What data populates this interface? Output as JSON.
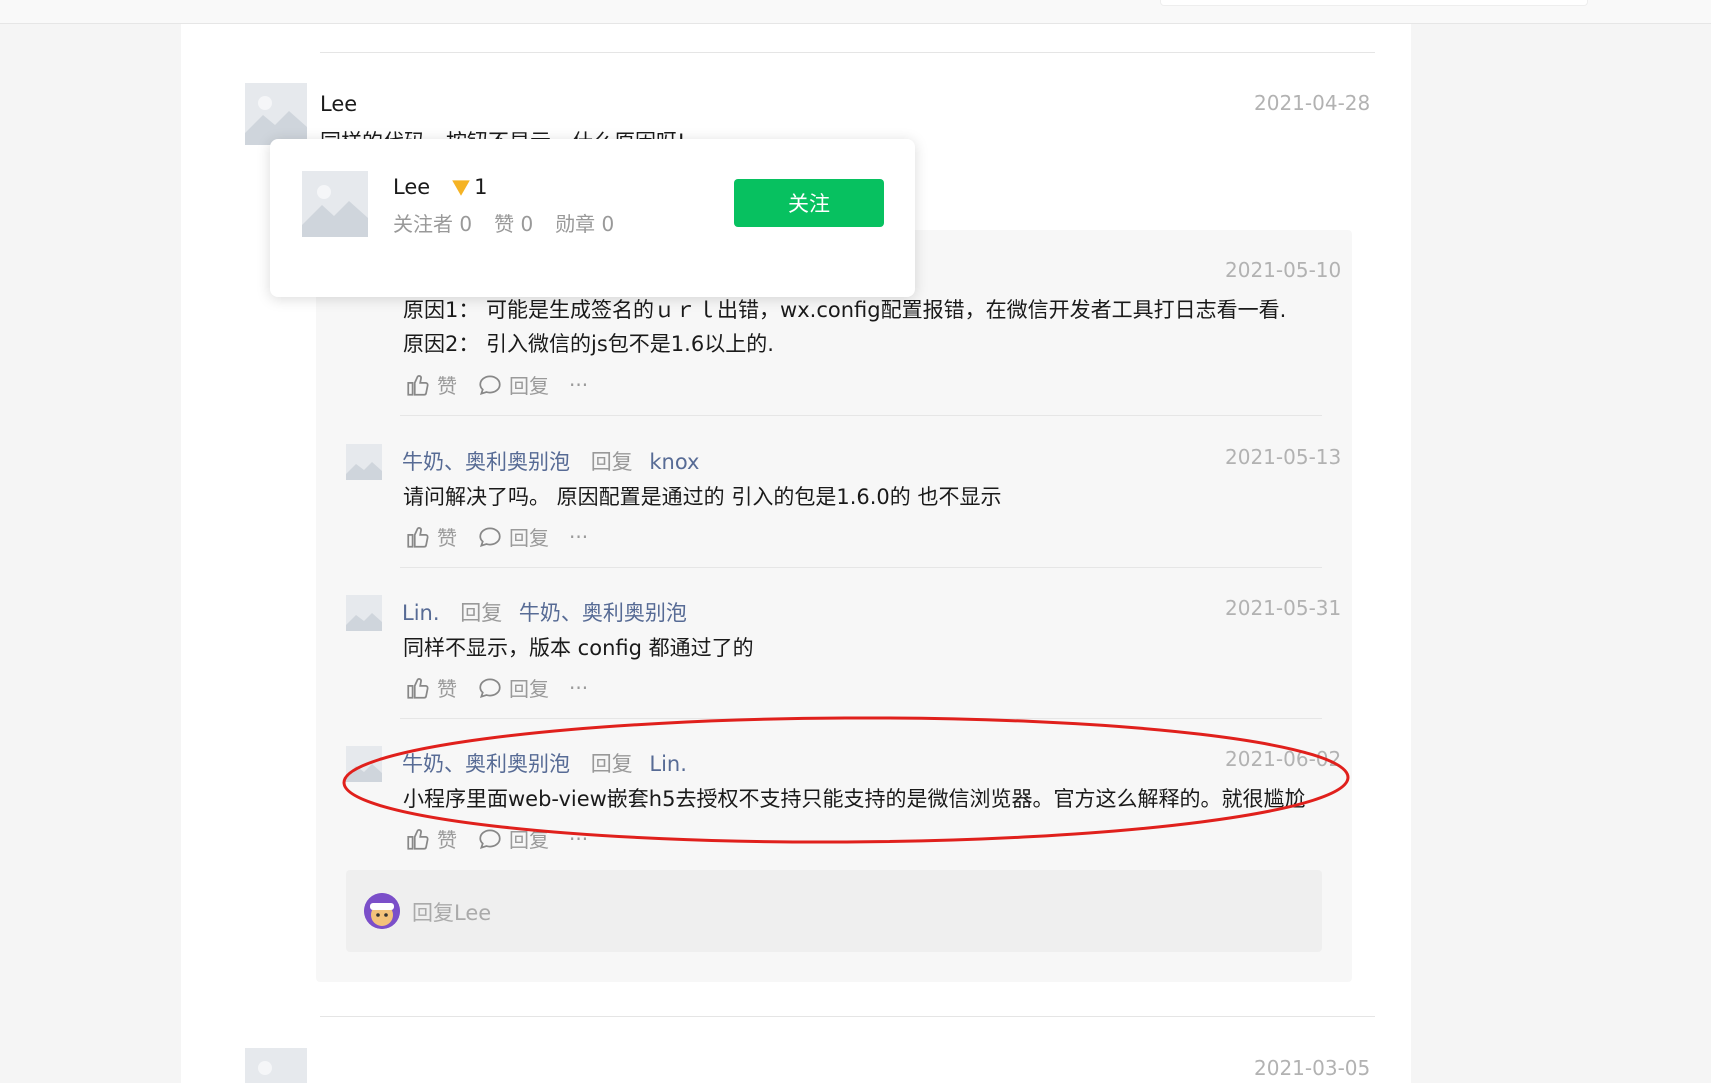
{
  "main_comment": {
    "author": "Lee",
    "date": "2021-04-28",
    "text_partial": "同样的代码，按钮不显示，什么原因呀!"
  },
  "popover": {
    "name": "Lee",
    "badge_count": "1",
    "stats": [
      {
        "label": "关注者",
        "value": "0"
      },
      {
        "label": "赞",
        "value": "0"
      },
      {
        "label": "勋章",
        "value": "0"
      }
    ],
    "follow_label": "关注"
  },
  "replies": [
    {
      "date": "2021-05-10",
      "lines": [
        "原因1：   可能是生成签名的ｕｒｌ出错，wx.config配置报错，在微信开发者工具打日志看一看.",
        "原因2：   引入微信的js包不是1.6以上的."
      ],
      "like": "赞",
      "reply": "回复",
      "more": "···"
    },
    {
      "author": "牛奶、奥利奥别泡",
      "reply_word": "回复",
      "target": "knox",
      "date": "2021-05-13",
      "text": "请问解决了吗。 原因配置是通过的  引入的包是1.6.0的  也不显示",
      "like": "赞",
      "reply": "回复",
      "more": "···"
    },
    {
      "author": "Lin.",
      "reply_word": "回复",
      "target": "牛奶、奥利奥别泡",
      "date": "2021-05-31",
      "text": "同样不显示，版本 config 都通过了的",
      "like": "赞",
      "reply": "回复",
      "more": "···"
    },
    {
      "author": "牛奶、奥利奥别泡",
      "reply_word": "回复",
      "target": "Lin.",
      "date": "2021-06-02",
      "text": "小程序里面web-view嵌套h5去授权不支持只能支持的是微信浏览器。官方这么解释的。就很尴尬",
      "like": "赞",
      "reply": "回复",
      "more": "···"
    }
  ],
  "reply_input": {
    "placeholder": "回复Lee"
  },
  "next_comment": {
    "date": "2021-03-05"
  },
  "colors": {
    "accent": "#07c160",
    "link": "#576b95",
    "annotation": "#e0201c"
  },
  "icons": [
    "thumb-up-icon",
    "comment-icon",
    "more-icon",
    "avatar-placeholder-icon",
    "badge-icon"
  ]
}
